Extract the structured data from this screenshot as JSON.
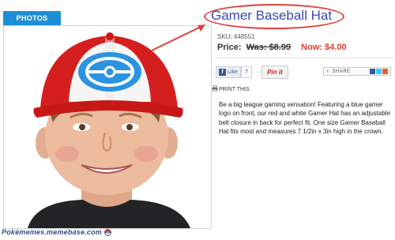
{
  "tab": {
    "label": "PHOTOS"
  },
  "product": {
    "title": "Gamer Baseball Hat",
    "sku": "SKU: 448551",
    "price_label": "Price:",
    "was_price": "Was: $8.99",
    "now_price": "Now: $4.00",
    "description": "Be a big league gaming sensation! Featuring a blue gamer logo on front, our red and white Gamer Hat has an adjustable belt closure in back for perfect fit. One size Gamer Baseball Hat fits most and measures 7 1/2in x 3in high in the crown."
  },
  "social": {
    "like_label": "Like",
    "like_count": "7",
    "pin_label": "Pin it",
    "share_label": "SHARE"
  },
  "print": {
    "label": "PRINT THIS"
  },
  "watermark": {
    "text": "Pokémemes.memebase.com"
  },
  "colors": {
    "tab_blue": "#1e8fd6",
    "title_blue": "#3a49b8",
    "sale_red": "#e53b2b",
    "annotation_red": "#e3403a"
  },
  "icons": [
    "facebook-icon",
    "pinterest-icon",
    "share-icon",
    "printer-icon",
    "pokeball-icon"
  ]
}
